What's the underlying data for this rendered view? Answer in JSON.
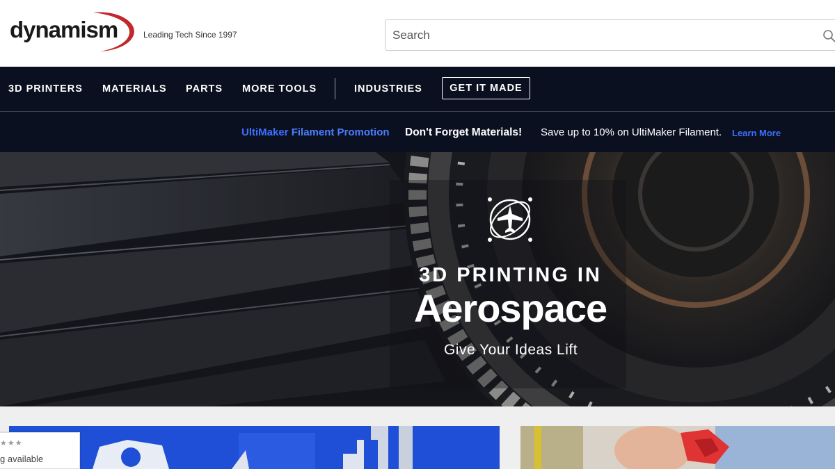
{
  "header": {
    "logo_text": "dynamism",
    "tagline": "Leading Tech Since 1997",
    "search_placeholder": "Search",
    "brand_colors": {
      "logo_swoosh": "#c0282d",
      "logo_text": "#1a1a1a"
    }
  },
  "nav": {
    "items": [
      {
        "label": "3D PRINTERS"
      },
      {
        "label": "MATERIALS"
      },
      {
        "label": "PARTS"
      },
      {
        "label": "MORE TOOLS"
      },
      {
        "label": "INDUSTRIES"
      }
    ],
    "cta_label": "GET IT MADE",
    "background": "#0b1020"
  },
  "promo": {
    "link_part1": "UltiMaker",
    "link_part2": "Filament Promotion",
    "title": "Don't Forget Materials!",
    "text": "Save up to 10% on UltiMaker Filament.",
    "learn_more": "Learn More",
    "link_color": "#3d6fff"
  },
  "hero": {
    "icon": "airplane-globe-icon",
    "kicker": "3D PRINTING IN",
    "title": "Aerospace",
    "subtitle": "Give Your Ideas Lift"
  },
  "rating_widget": {
    "stars": "★★★",
    "text": "g available"
  }
}
